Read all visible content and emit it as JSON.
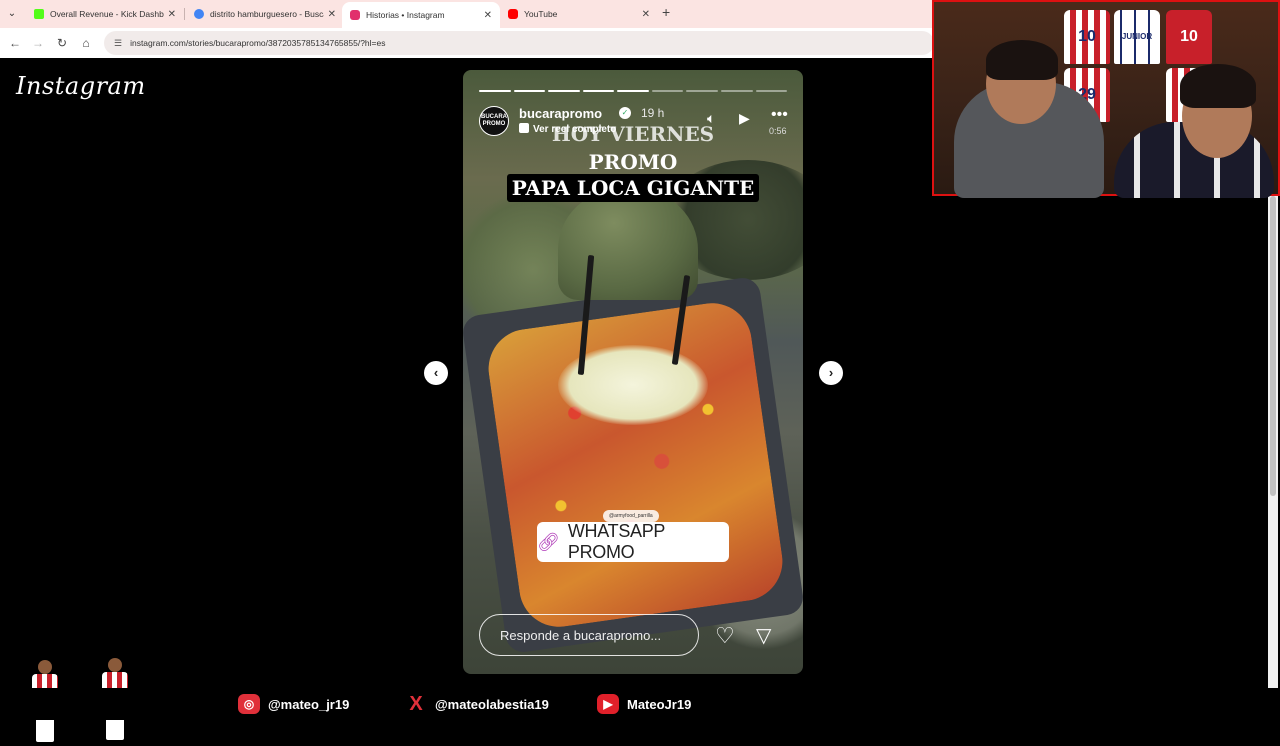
{
  "browser": {
    "tabs": [
      {
        "label": "Overall Revenue - Kick Dashbo",
        "favicon_color": "#53fc18",
        "active": false
      },
      {
        "label": "distrito hamburguesero - Busca",
        "favicon_color": "#4285f4",
        "active": false
      },
      {
        "label": "Historias • Instagram",
        "favicon_color": "#e1306c",
        "active": true
      },
      {
        "label": "YouTube",
        "favicon_color": "#ff0000",
        "active": false
      }
    ],
    "url": "instagram.com/stories/bucarapromo/3872035785134765855/?hl=es"
  },
  "instagram": {
    "logo": "Instagram",
    "story": {
      "username": "bucarapromo",
      "time": "19 h",
      "reel_link": "Ver reel completo",
      "duration": "0:56",
      "avatar_text": "BUCARA PROMO",
      "headline_line1": "HOY VIERNES",
      "headline_line2": "PROMO",
      "headline_line3": "PAPA LOCA GIGANTE",
      "credit": "@armyfood_parrilla",
      "sticker_text": "WHATSAPP PROMO",
      "reply_placeholder": "Responde a bucarapromo...",
      "progress_segments": 9,
      "progress_done": 5
    }
  },
  "social": [
    {
      "icon": "instagram-icon",
      "handle": "@mateo_jr19"
    },
    {
      "icon": "x-icon",
      "handle": "@mateolabestia19"
    },
    {
      "icon": "youtube-icon",
      "handle": "MateoJr19"
    }
  ],
  "webcam": {
    "jersey_numbers": [
      "10",
      "JUNIOR",
      "10",
      "29",
      "7",
      "17"
    ]
  },
  "colors": {
    "chrome_bg": "#fbe4e2",
    "accent_red": "#e0303a",
    "instagram_pink": "#e1306c"
  }
}
